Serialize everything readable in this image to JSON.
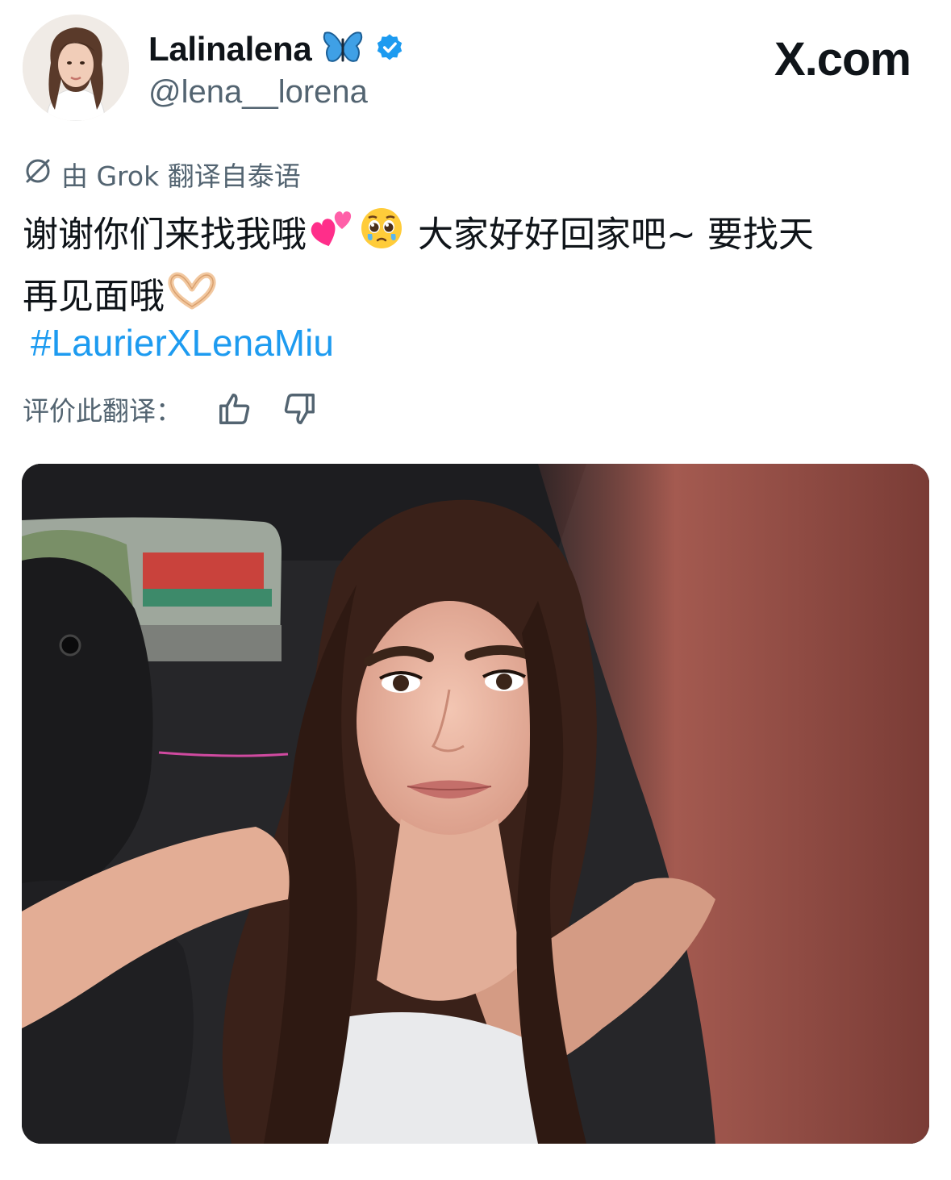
{
  "author": {
    "display_name": "Lalinalena",
    "name_emoji": "butterfly-emoji",
    "verified": "verified-badge-icon",
    "handle": "@lena__lorena"
  },
  "brand": {
    "text": "X.com"
  },
  "translation": {
    "notice": "由 Grok 翻译自泰语",
    "rate_label": "评价此翻译："
  },
  "tweet": {
    "line1_part1": "谢谢你们来找我哦",
    "line1_part2": " 大家好好回家吧~ 要找天",
    "line2": "再见面哦",
    "emojis": [
      "two-hearts-emoji",
      "pleading-face-emoji",
      "heart-hands-emoji"
    ],
    "hashtag": "#LaurierXLenaMiu"
  },
  "colors": {
    "text_primary": "#0f1419",
    "text_secondary": "#536471",
    "link": "#1d9bf0",
    "verified": "#1d9bf0",
    "butterfly": "#3fa0e6"
  },
  "media": {
    "type": "photo",
    "subject": "selfie-in-car-photo"
  }
}
